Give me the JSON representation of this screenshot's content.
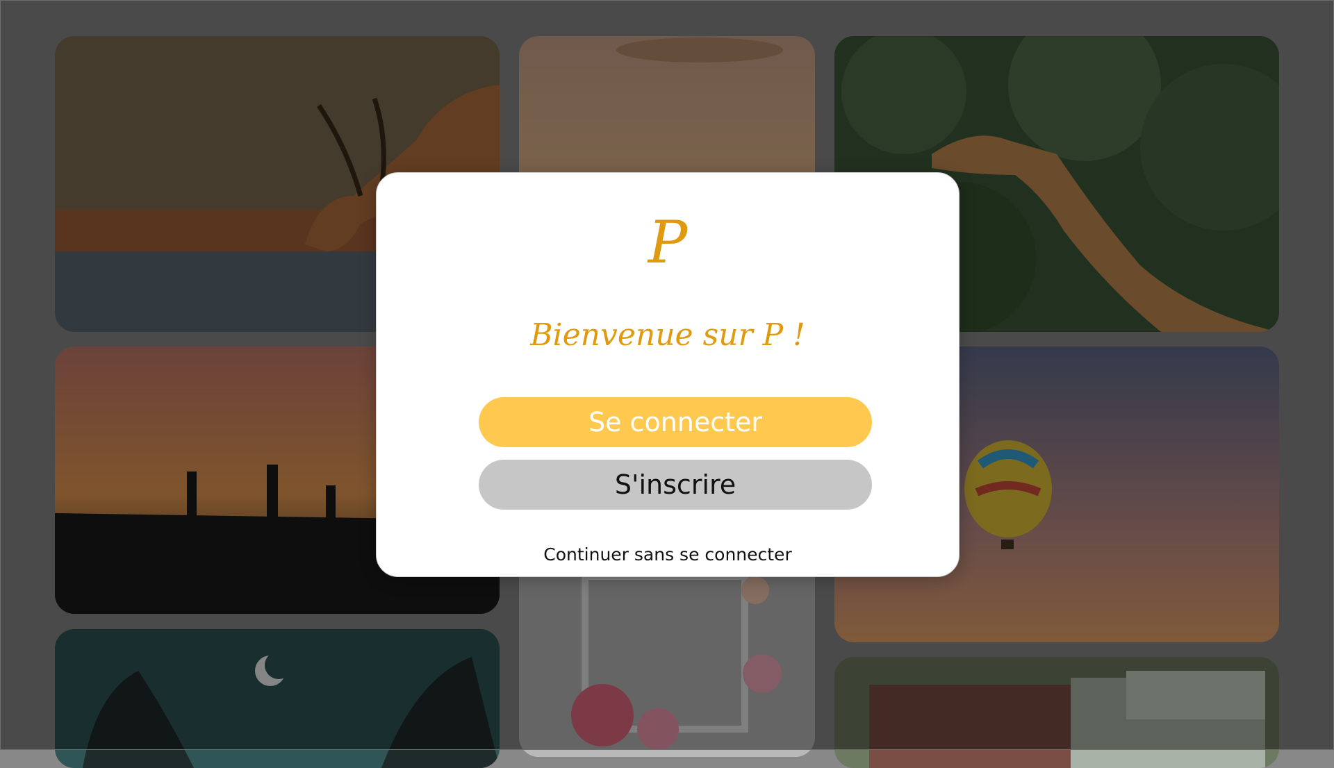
{
  "modal": {
    "logo": "P",
    "welcome": "Bienvenue sur P !",
    "login_label": "Se connecter",
    "signup_label": "S'inscrire",
    "continue_label": "Continuer sans se connecter"
  },
  "colors": {
    "brand": "#e09a10",
    "login_button": "#ffc94f",
    "signup_button": "#c6c6c6",
    "overlay": "#888888"
  },
  "gallery": [
    {
      "name": "impala-drinking-photo",
      "icon": "impala-photo"
    },
    {
      "name": "sunset-sky-photo",
      "icon": "sky-photo"
    },
    {
      "name": "giraffe-photo",
      "icon": "giraffe-photo"
    },
    {
      "name": "fishermen-sunset-photo",
      "icon": "fishermen-photo"
    },
    {
      "name": "flowers-frame-photo",
      "icon": "flowers-photo"
    },
    {
      "name": "hot-air-balloon-photo",
      "icon": "balloon-photo"
    },
    {
      "name": "crescent-moon-photo",
      "icon": "moon-photo"
    },
    {
      "name": "vintage-car-photo",
      "icon": "car-photo"
    }
  ]
}
